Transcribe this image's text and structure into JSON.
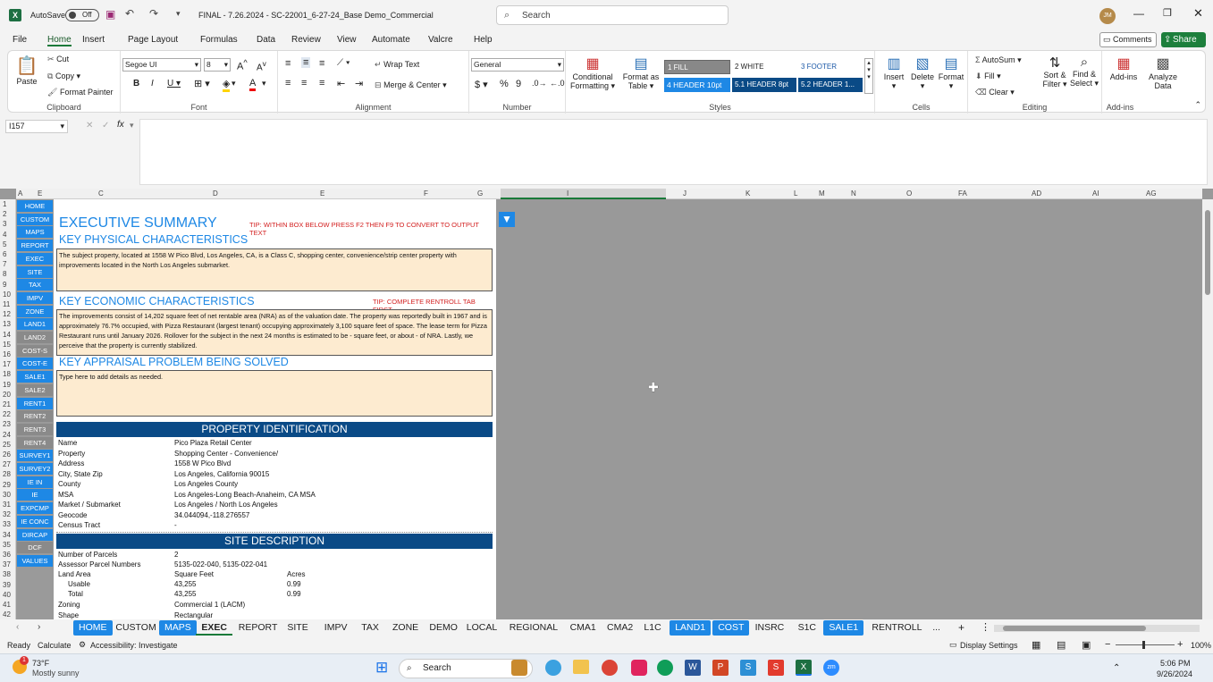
{
  "title": {
    "autosave": "AutoSave",
    "autosave_state": "Off",
    "filename": "FINAL - 7.26.2024 - SC-22001_6-27-24_Base Demo_Commercial",
    "search_placeholder": "Search",
    "avatar": "JM"
  },
  "menu": [
    "File",
    "Home",
    "Insert",
    "Page Layout",
    "Formulas",
    "Data",
    "Review",
    "View",
    "Automate",
    "Valcre",
    "Help"
  ],
  "menu_active": "Home",
  "share": {
    "comments": "Comments",
    "share": "Share"
  },
  "ribbon": {
    "paste": "Paste",
    "cut": "Cut",
    "copy": "Copy",
    "format_painter": "Format Painter",
    "clipboard": "Clipboard",
    "font_name": "Segoe UI",
    "font_size": "8",
    "font": "Font",
    "wrap_text": "Wrap Text",
    "merge_center": "Merge & Center",
    "alignment": "Alignment",
    "number_format": "General",
    "number": "Number",
    "conditional": "Conditional",
    "formatting": "Formatting",
    "format_as": "Format as",
    "table": "Table",
    "styles_cells": [
      "1 FILL",
      "2 WHITE",
      "3 FOOTER",
      "4 HEADER 10pt",
      "5.1 HEADER 8pt",
      "5.2 HEADER 1..."
    ],
    "styles": "Styles",
    "insert": "Insert",
    "delete": "Delete",
    "format": "Format",
    "cells": "Cells",
    "autosum": "AutoSum",
    "fill": "Fill",
    "clear": "Clear",
    "sort_filter": "Sort &",
    "filter": "Filter",
    "find_select": "Find &",
    "select": "Select",
    "editing": "Editing",
    "addins": "Add-ins",
    "addins_group": "Add-ins",
    "analyze": "Analyze",
    "data": "Data"
  },
  "namebox": "I157",
  "fx": "fx",
  "columns": [
    "A",
    "E",
    "C",
    "D",
    "E",
    "F",
    "G",
    "I",
    "J",
    "K",
    "L",
    "M",
    "N",
    "O",
    "FA",
    "AD",
    "AI",
    "AG"
  ],
  "rows": [
    "1",
    "2",
    "3",
    "4",
    "5",
    "6",
    "7",
    "8",
    "9",
    "10",
    "11",
    "12",
    "13",
    "14",
    "15",
    "16",
    "17",
    "18",
    "19",
    "20",
    "21",
    "22",
    "23",
    "24",
    "25",
    "26",
    "27",
    "28",
    "29",
    "30",
    "31",
    "32",
    "33",
    "34",
    "35",
    "36",
    "37",
    "38",
    "39",
    "40",
    "41",
    "42"
  ],
  "nav": [
    {
      "label": "HOME",
      "color": "#1e88e5"
    },
    {
      "label": "CUSTOM",
      "color": "#1e88e5"
    },
    {
      "label": "MAPS",
      "color": "#1e88e5"
    },
    {
      "label": "REPORT",
      "color": "#1e88e5"
    },
    {
      "label": "EXEC",
      "color": "#1e88e5"
    },
    {
      "label": "SITE",
      "color": "#1e88e5"
    },
    {
      "label": "TAX",
      "color": "#1e88e5"
    },
    {
      "label": "IMPV",
      "color": "#1e88e5"
    },
    {
      "label": "ZONE",
      "color": "#1e88e5"
    },
    {
      "label": "LAND1",
      "color": "#1e88e5"
    },
    {
      "label": "LAND2",
      "color": "#8a8a8a"
    },
    {
      "label": "COST-S",
      "color": "#8a8a8a"
    },
    {
      "label": "COST-E",
      "color": "#1e88e5"
    },
    {
      "label": "SALE1",
      "color": "#1e88e5"
    },
    {
      "label": "SALE2",
      "color": "#8a8a8a"
    },
    {
      "label": "RENT1",
      "color": "#1e88e5"
    },
    {
      "label": "RENT2",
      "color": "#8a8a8a"
    },
    {
      "label": "RENT3",
      "color": "#8a8a8a"
    },
    {
      "label": "RENT4",
      "color": "#8a8a8a"
    },
    {
      "label": "SURVEY1",
      "color": "#1e88e5"
    },
    {
      "label": "SURVEY2",
      "color": "#1e88e5"
    },
    {
      "label": "IE IN",
      "color": "#1e88e5"
    },
    {
      "label": "IE",
      "color": "#1e88e5"
    },
    {
      "label": "EXPCMP",
      "color": "#1e88e5"
    },
    {
      "label": "IE CONC",
      "color": "#1e88e5"
    },
    {
      "label": "DIRCAP",
      "color": "#1e88e5"
    },
    {
      "label": "DCF",
      "color": "#8a8a8a"
    },
    {
      "label": "VALUES",
      "color": "#1e88e5"
    }
  ],
  "sheet": {
    "exec_title": "EXECUTIVE SUMMARY",
    "tip1": "TIP: WITHIN BOX BELOW PRESS F2 THEN F9 TO CONVERT TO OUTPUT TEXT",
    "physical_title": "KEY PHYSICAL CHARACTERISTICS",
    "physical_text": "The subject property, located at 1558 W Pico Blvd, Los Angeles, CA, is a Class C, shopping center, convenience/strip center property with improvements located in the North Los Angeles submarket.",
    "economic_title": "KEY ECONOMIC CHARACTERISTICS",
    "tip2": "TIP: COMPLETE RENTROLL TAB FIRST",
    "economic_text": "The improvements consist of 14,202 square feet of net rentable area (NRA) as of the valuation date. The property was reportedly built in 1967 and is approximately 76.7% occupied, with Pizza Restaurant (largest tenant) occupying approximately 3,100 square feet of space. The lease term for Pizza Restaurant runs until January 2026. Rollover for the subject in the next 24 months is estimated to be - square feet, or about - of NRA. Lastly, we perceive that the property is currently stabilized.",
    "problem_title": "KEY APPRAISAL PROBLEM BEING SOLVED",
    "problem_text": "Type here to add details as needed.",
    "pid_title": "PROPERTY IDENTIFICATION",
    "pid": [
      [
        "Name",
        "Pico Plaza Retail Center"
      ],
      [
        "Property",
        "Shopping Center - Convenience/"
      ],
      [
        "Address",
        "1558 W Pico Blvd"
      ],
      [
        "City, State Zip",
        "Los Angeles, California 90015"
      ],
      [
        "County",
        "Los Angeles County"
      ],
      [
        "MSA",
        "Los Angeles-Long Beach-Anaheim, CA MSA"
      ],
      [
        "Market / Submarket",
        "Los Angeles / North Los Angeles"
      ],
      [
        "Geocode",
        "34.044094,-118.276557"
      ],
      [
        "Census Tract",
        "-"
      ]
    ],
    "site_title": "SITE DESCRIPTION",
    "site": {
      "parcels_label": "Number of Parcels",
      "parcels": "2",
      "apn_label": "Assessor Parcel Numbers",
      "apn": "5135-022-040, 5135-022-041",
      "land_label": "Land Area",
      "sf_head": "Square Feet",
      "ac_head": "Acres",
      "usable_label": "Usable",
      "usable_sf": "43,255",
      "usable_ac": "0.99",
      "total_label": "Total",
      "total_sf": "43,255",
      "total_ac": "0.99",
      "zoning_label": "Zoning",
      "zoning": "Commercial 1 (LACM)",
      "shape_label": "Shape",
      "shape": "Rectangular"
    }
  },
  "tabs": [
    {
      "label": "HOME",
      "style": "blue"
    },
    {
      "label": "CUSTOM",
      "style": "plain"
    },
    {
      "label": "MAPS",
      "style": "blue"
    },
    {
      "label": "EXEC",
      "style": "active"
    },
    {
      "label": "REPORT",
      "style": "plain"
    },
    {
      "label": "SITE",
      "style": "plain"
    },
    {
      "label": "IMPV",
      "style": "plain"
    },
    {
      "label": "TAX",
      "style": "plain"
    },
    {
      "label": "ZONE",
      "style": "plain"
    },
    {
      "label": "DEMO",
      "style": "plain"
    },
    {
      "label": "LOCAL",
      "style": "plain"
    },
    {
      "label": "REGIONAL",
      "style": "plain"
    },
    {
      "label": "CMA1",
      "style": "plain"
    },
    {
      "label": "CMA2",
      "style": "plain"
    },
    {
      "label": "L1C",
      "style": "plain"
    },
    {
      "label": "LAND1",
      "style": "blue"
    },
    {
      "label": "COST",
      "style": "blue"
    },
    {
      "label": "INSRC",
      "style": "plain"
    },
    {
      "label": "S1C",
      "style": "plain"
    },
    {
      "label": "SALE1",
      "style": "blue"
    },
    {
      "label": "RENTROLL",
      "style": "plain"
    },
    {
      "label": "...",
      "style": "plain"
    }
  ],
  "status": {
    "ready": "Ready",
    "calculate": "Calculate",
    "accessibility": "Accessibility: Investigate",
    "display": "Display Settings",
    "zoom": "100%"
  },
  "taskbar": {
    "temp": "73°F",
    "weather": "Mostly sunny",
    "search": "Search",
    "time": "5:06 PM",
    "date": "9/26/2024",
    "badge1": "1"
  }
}
